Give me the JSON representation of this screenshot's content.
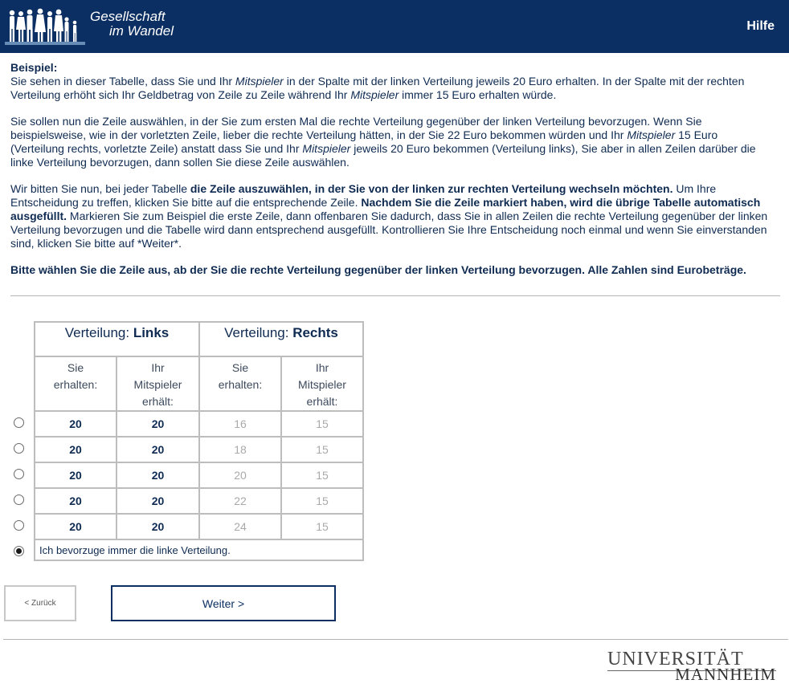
{
  "header": {
    "logo_line1": "Gesellschaft",
    "logo_line2": "im Wandel",
    "help_label": "Hilfe"
  },
  "instructions": {
    "example_heading": "Beispiel:",
    "p1_a": "Sie sehen in dieser Tabelle, dass Sie und Ihr ",
    "p1_b": "Mitspieler",
    "p1_c": " in der Spalte mit der linken Verteilung jeweils 20 Euro erhalten. In der Spalte mit der rechten Verteilung erhöht sich Ihr Geldbetrag von Zeile zu Zeile während Ihr ",
    "p1_d": "Mitspieler",
    "p1_e": " immer 15 Euro erhalten würde.",
    "p2_a": "Sie sollen nun die Zeile auswählen, in der Sie zum ersten Mal die rechte Verteilung gegenüber der linken Verteilung bevorzugen. Wenn Sie beispielsweise, wie in der vorletzten Zeile, lieber die rechte Verteilung hätten, in der Sie 22 Euro bekommen würden und Ihr ",
    "p2_b": "Mitspieler",
    "p2_c": " 15 Euro (Verteilung rechts, vorletzte Zeile) anstatt dass Sie und Ihr ",
    "p2_d": "Mitspieler",
    "p2_e": " jeweils 20 Euro bekommen (Verteilung links), Sie aber in allen Zeilen darüber die linke Verteilung bevorzugen, dann sollen Sie diese Zeile auswählen.",
    "p3_a": "Wir bitten Sie nun, bei jeder Tabelle ",
    "p3_b": "die Zeile auszuwählen, in der Sie von der linken zur rechten Verteilung wechseln möchten.",
    "p3_c": " Um Ihre Entscheidung zu treffen, klicken Sie bitte auf die entsprechende Zeile. ",
    "p3_d": "Nachdem Sie die Zeile markiert haben, wird die übrige Tabelle automatisch ausgefüllt.",
    "p3_e": " Markieren Sie zum Beispiel die erste Zeile, dann offenbaren Sie dadurch, dass Sie in allen Zeilen die rechte Verteilung gegenüber der linken Verteilung bevorzugen und die Tabelle wird dann entsprechend ausgefüllt. Kontrollieren Sie Ihre Entscheidung noch einmal und wenn Sie einverstanden sind, klicken Sie bitte auf *Weiter*.",
    "question": "Bitte wählen Sie die Zeile aus, ab der Sie die rechte Verteilung gegenüber der linken Verteilung bevorzugen. Alle Zahlen sind Eurobeträge."
  },
  "table": {
    "left_prefix": "Verteilung: ",
    "left_bold": "Links",
    "right_prefix": "Verteilung: ",
    "right_bold": "Rechts",
    "col_you_1": "Sie",
    "col_you_2": "erhalten:",
    "col_partner_1": "Ihr",
    "col_partner_2": "Mitspieler",
    "col_partner_3": "erhält:",
    "rows": [
      {
        "left_you": "20",
        "left_partner": "20",
        "right_you": "16",
        "right_partner": "15"
      },
      {
        "left_you": "20",
        "left_partner": "20",
        "right_you": "18",
        "right_partner": "15"
      },
      {
        "left_you": "20",
        "left_partner": "20",
        "right_you": "20",
        "right_partner": "15"
      },
      {
        "left_you": "20",
        "left_partner": "20",
        "right_you": "22",
        "right_partner": "15"
      },
      {
        "left_you": "20",
        "left_partner": "20",
        "right_you": "24",
        "right_partner": "15"
      }
    ],
    "always_left_label": "Ich bevorzuge immer die linke Verteilung.",
    "selected_option": "always-left"
  },
  "nav": {
    "back_label": "< Zurück",
    "next_label": "Weiter >"
  },
  "footer": {
    "uni_line1": "UNIVERSITÄT",
    "uni_line2": "MANNHEIM"
  },
  "colors": {
    "brand_navy": "#0b2f62",
    "text_navy": "#0f2b52",
    "table_border": "#bdbdbd"
  }
}
